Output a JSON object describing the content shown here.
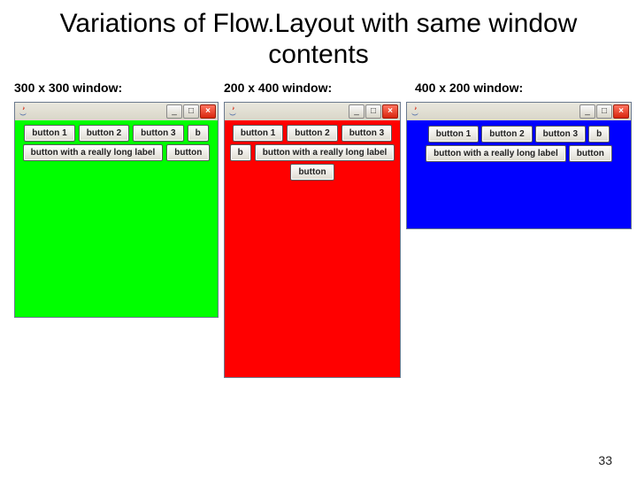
{
  "title": "Variations of Flow.Layout with same window contents",
  "page_number": "33",
  "windows": {
    "green": {
      "label": "300 x 300 window:",
      "bg": "#00ff00",
      "buttons": [
        "button 1",
        "button 2",
        "button 3",
        "b",
        "button with a really long label",
        "button"
      ]
    },
    "red": {
      "label": "200 x 400 window:",
      "bg": "#ff0000",
      "buttons": [
        "button 1",
        "button 2",
        "button 3",
        "b",
        "button with a really long label",
        "button"
      ]
    },
    "blue": {
      "label": "400 x 200 window:",
      "bg": "#0000ff",
      "buttons": [
        "button 1",
        "button 2",
        "button 3",
        "b",
        "button with a really long label",
        "button"
      ]
    }
  }
}
